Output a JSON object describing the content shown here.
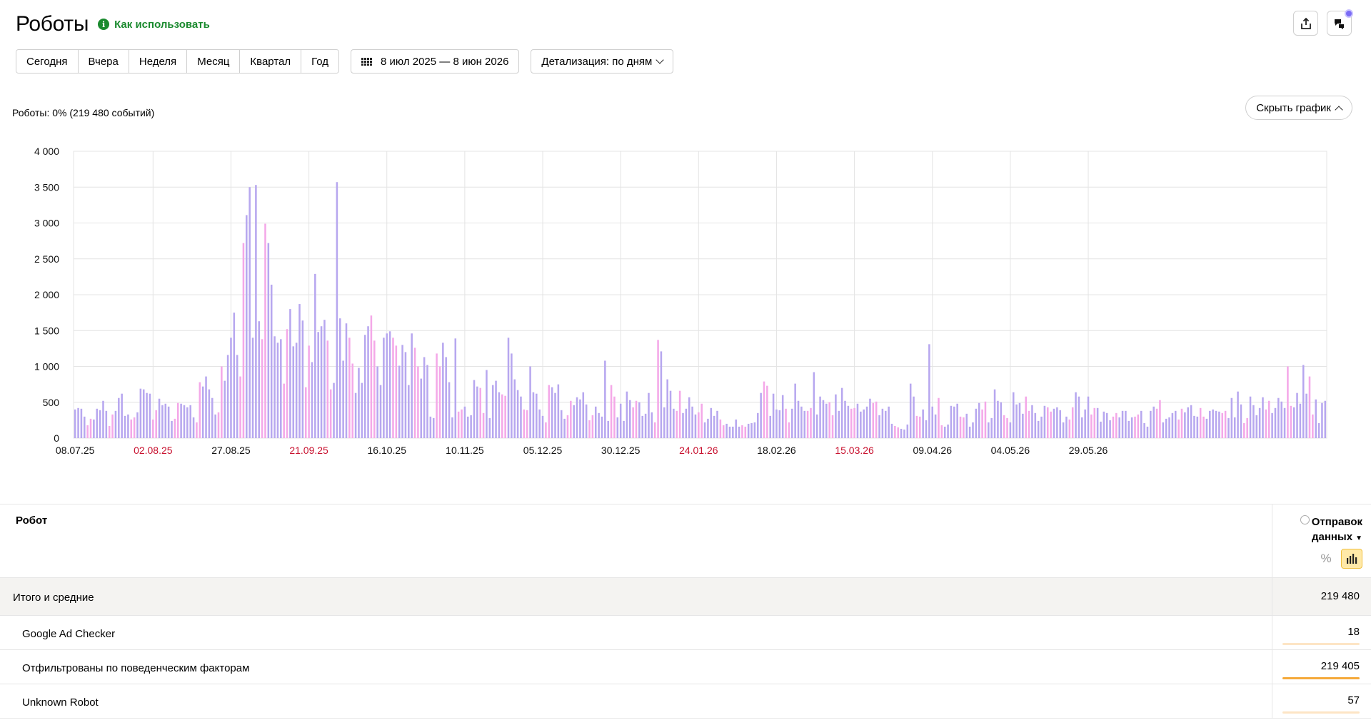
{
  "header": {
    "title": "Роботы",
    "howto": "Как использовать"
  },
  "toolbar": {
    "periods": [
      "Сегодня",
      "Вчера",
      "Неделя",
      "Месяц",
      "Квартал",
      "Год"
    ],
    "date_range": "8 июл 2025 — 8 июн 2026",
    "detail": "Детализация: по дням"
  },
  "summary": "Роботы: 0% (219 480 событий)",
  "hide_chart": "Скрыть график",
  "icons": {
    "export": "export-icon",
    "notifications": "notifications-icon",
    "info": "info-icon",
    "calendar": "calendar-grid-icon"
  },
  "colors": {
    "accent_green": "#1a8a2e",
    "bar_weekday": "#b7a7ef",
    "bar_weekend": "#f4a8e8",
    "holiday_tick": "#c8102e",
    "active_toggle": "#ffe9a8",
    "row_bar": "#f5a93a"
  },
  "chart_data": {
    "type": "bar",
    "ylim": [
      0,
      4000
    ],
    "yticks": [
      "0",
      "500",
      "1 000",
      "1 500",
      "2 000",
      "2 500",
      "3 000",
      "3 500",
      "4 000"
    ],
    "xticks": [
      {
        "label": "08.07.25",
        "holiday": false
      },
      {
        "label": "02.08.25",
        "holiday": true
      },
      {
        "label": "27.08.25",
        "holiday": false
      },
      {
        "label": "21.09.25",
        "holiday": true
      },
      {
        "label": "16.10.25",
        "holiday": false
      },
      {
        "label": "10.11.25",
        "holiday": false
      },
      {
        "label": "05.12.25",
        "holiday": false
      },
      {
        "label": "30.12.25",
        "holiday": false
      },
      {
        "label": "24.01.26",
        "holiday": true
      },
      {
        "label": "18.02.26",
        "holiday": false
      },
      {
        "label": "15.03.26",
        "holiday": true
      },
      {
        "label": "09.04.26",
        "holiday": false
      },
      {
        "label": "04.05.26",
        "holiday": false
      },
      {
        "label": "29.05.26",
        "holiday": false
      }
    ],
    "start_weekday": 1,
    "values": [
      400,
      420,
      410,
      300,
      180,
      270,
      260,
      410,
      390,
      520,
      380,
      170,
      330,
      380,
      560,
      620,
      310,
      330,
      260,
      290,
      360,
      690,
      680,
      630,
      620,
      260,
      390,
      550,
      460,
      480,
      440,
      240,
      270,
      490,
      480,
      460,
      430,
      460,
      290,
      220,
      780,
      720,
      860,
      680,
      560,
      330,
      360,
      1000,
      800,
      1160,
      1400,
      1750,
      1160,
      860,
      2720,
      3110,
      3500,
      1400,
      3530,
      1630,
      1380,
      2990,
      2720,
      2140,
      1420,
      1330,
      1380,
      760,
      1520,
      1800,
      1280,
      1330,
      1870,
      1640,
      710,
      1290,
      1060,
      2290,
      1480,
      1560,
      1650,
      1360,
      680,
      770,
      3570,
      1670,
      1080,
      1600,
      1400,
      1040,
      630,
      980,
      770,
      1440,
      1560,
      1710,
      1360,
      1000,
      740,
      1400,
      1460,
      1490,
      1400,
      1290,
      1010,
      1300,
      1200,
      740,
      1460,
      1260,
      1000,
      830,
      1130,
      1020,
      300,
      280,
      1180,
      1000,
      1330,
      1130,
      780,
      290,
      1390,
      370,
      400,
      440,
      300,
      320,
      810,
      720,
      700,
      350,
      950,
      280,
      740,
      800,
      640,
      610,
      590,
      1400,
      1180,
      820,
      670,
      580,
      400,
      390,
      1000,
      640,
      620,
      400,
      310,
      220,
      740,
      710,
      630,
      750,
      390,
      270,
      320,
      520,
      460,
      570,
      540,
      640,
      470,
      250,
      320,
      440,
      350,
      300,
      1080,
      240,
      740,
      580,
      290,
      480,
      240,
      650,
      530,
      430,
      520,
      500,
      310,
      340,
      630,
      360,
      220,
      1370,
      1210,
      430,
      820,
      660,
      410,
      380,
      660,
      350,
      410,
      570,
      440,
      330,
      360,
      480,
      220,
      270,
      420,
      310,
      380,
      260,
      180,
      200,
      160,
      160,
      260,
      160,
      180,
      160,
      200,
      210,
      220,
      350,
      630,
      790,
      730,
      310,
      620,
      400,
      390,
      600,
      410,
      220,
      410,
      760,
      520,
      440,
      380,
      380,
      420,
      920,
      330,
      580,
      530,
      480,
      500,
      320,
      610,
      380,
      700,
      520,
      450,
      410,
      420,
      480,
      370,
      400,
      440,
      550,
      490,
      510,
      320,
      410,
      380,
      440,
      200,
      170,
      150,
      130,
      120,
      190,
      760,
      580,
      310,
      300,
      400,
      250,
      1310,
      440,
      330,
      560,
      180,
      160,
      190,
      450,
      440,
      480,
      300,
      290,
      340,
      160,
      220,
      410,
      490,
      400,
      510,
      220,
      280,
      680,
      520,
      500,
      320,
      280,
      220,
      640,
      470,
      490,
      340,
      580,
      380,
      460,
      350,
      240,
      300,
      450,
      430,
      370,
      410,
      430,
      390,
      220,
      300,
      260,
      430,
      640,
      580,
      290,
      400,
      580,
      330,
      420,
      420,
      230,
      370,
      350,
      250,
      300,
      350,
      290,
      380,
      380,
      240,
      290,
      300,
      330,
      380,
      210,
      160,
      380,
      440,
      410,
      530,
      220,
      270,
      290,
      350,
      380,
      260,
      410,
      360,
      430,
      460,
      310,
      300,
      420,
      300,
      270,
      380,
      400,
      380,
      370,
      350,
      380,
      280,
      560,
      290,
      650,
      470,
      210,
      280,
      580,
      460,
      320,
      420,
      570,
      400,
      520,
      350,
      420,
      560,
      510,
      420,
      1000,
      450,
      430,
      630,
      480,
      1020,
      620,
      860,
      330,
      540,
      210,
      490,
      520
    ]
  },
  "table": {
    "col_robot": "Робот",
    "col_metric": "Отправок данных",
    "sort_icon": "▼",
    "toggle_percent": "%",
    "total": {
      "label": "Итого и средние",
      "value": "219 480"
    },
    "rows": [
      {
        "label": "Google Ad Checker",
        "value": "18",
        "share": 0.0001
      },
      {
        "label": "Отфильтрованы по поведенческим факторам",
        "value": "219 405",
        "share": 0.9997
      },
      {
        "label": "Unknown Robot",
        "value": "57",
        "share": 0.0003
      }
    ]
  }
}
